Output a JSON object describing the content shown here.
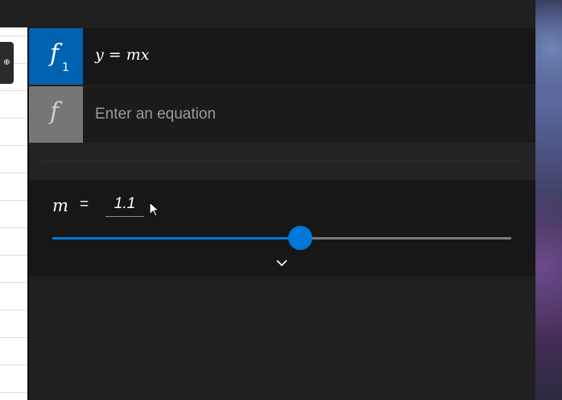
{
  "graph": {
    "tool_label": "⊕"
  },
  "functions": [
    {
      "badge_letter": "f",
      "badge_sub": "1",
      "expression": "y = mx",
      "color": "#0063b1"
    },
    {
      "badge_letter": "f",
      "placeholder": "Enter an equation",
      "color": "#767676"
    }
  ],
  "variable": {
    "name": "m",
    "equals": "=",
    "value": "1.1",
    "slider_fraction": 0.54,
    "accent": "#0078d7"
  },
  "icons": {
    "expand": "chevron-down-icon",
    "cursor": "mouse-pointer-icon"
  }
}
